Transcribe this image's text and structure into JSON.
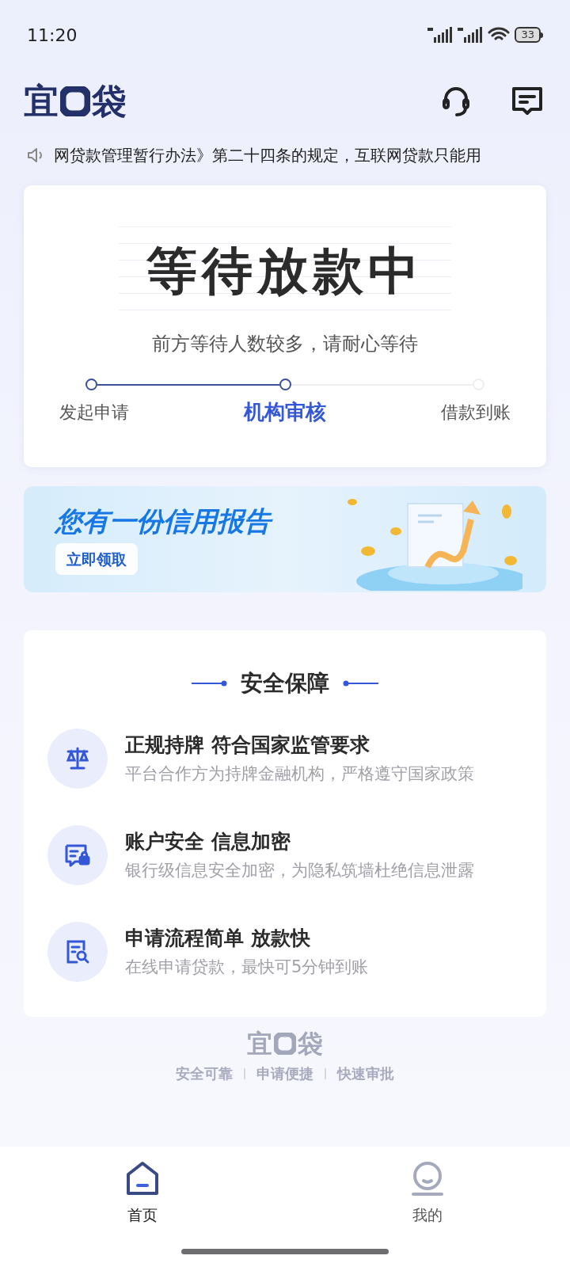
{
  "status_bar": {
    "time": "11:20",
    "battery": "33"
  },
  "header": {
    "logo": {
      "left": "宜",
      "right": "袋"
    }
  },
  "notice": {
    "text": "网贷款管理暂行办法》第二十四条的规定，互联网贷款只能用"
  },
  "status_card": {
    "title": "等待放款中",
    "subtitle": "前方等待人数较多，请耐心等待",
    "steps": [
      {
        "label": "发起申请",
        "completed": true,
        "selected": false
      },
      {
        "label": "机构审核",
        "completed": true,
        "selected": true
      },
      {
        "label": "借款到账",
        "completed": false,
        "selected": false
      }
    ]
  },
  "banner": {
    "title": "您有一份信用报告",
    "button": "立即领取"
  },
  "security": {
    "title": "安全保障",
    "items": [
      {
        "kind": "license",
        "title": "正规持牌 符合国家监管要求",
        "desc": "平台合作方为持牌金融机构，严格遵守国家政策"
      },
      {
        "kind": "account",
        "title": "账户安全 信息加密",
        "desc": "银行级信息安全加密，为隐私筑墙杜绝信息泄露"
      },
      {
        "kind": "process",
        "title": "申请流程简单 放款快",
        "desc": "在线申请贷款，最快可5分钟到账"
      }
    ]
  },
  "footer": {
    "logo": {
      "left": "宜",
      "right": "袋"
    },
    "taglines": [
      "安全可靠",
      "申请便捷",
      "快速审批"
    ]
  },
  "tab_bar": [
    {
      "kind": "home",
      "label": "首页",
      "selected": true
    },
    {
      "kind": "profile",
      "label": "我的",
      "selected": false
    }
  ]
}
